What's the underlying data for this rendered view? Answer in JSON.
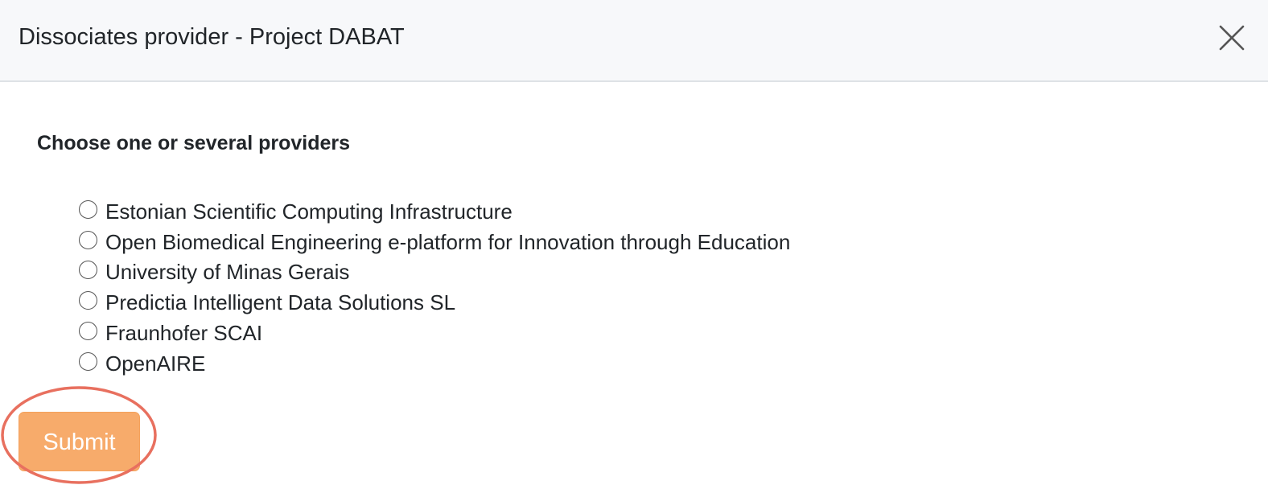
{
  "modal": {
    "title": "Dissociates provider - Project DABAT",
    "close_icon": "close-x-icon"
  },
  "form": {
    "heading": "Choose one or several providers",
    "providers": [
      {
        "label": "Estonian Scientific Computing Infrastructure",
        "selected": false
      },
      {
        "label": "Open Biomedical Engineering e-platform for Innovation through Education",
        "selected": false
      },
      {
        "label": "University of Minas Gerais",
        "selected": false
      },
      {
        "label": "Predictia Intelligent Data Solutions SL",
        "selected": false
      },
      {
        "label": "Fraunhofer SCAI",
        "selected": false
      },
      {
        "label": "OpenAIRE",
        "selected": false
      }
    ],
    "submit_label": "Submit"
  },
  "colors": {
    "header_background": "#f7f8fa",
    "submit_background": "#f7ab6b",
    "annotation_ring": "#e8705f"
  }
}
